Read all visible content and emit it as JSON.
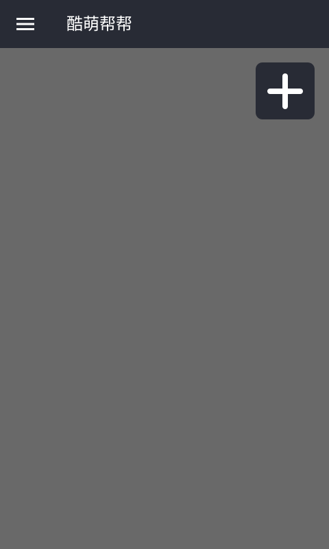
{
  "app_bar": {
    "title": "酷萌帮帮",
    "menu_icon": "hamburger-menu-icon",
    "background_color": "#282b35"
  },
  "content": {
    "background_color": "#696969"
  },
  "fab": {
    "icon": "plus-icon",
    "background_color": "#282b35"
  }
}
